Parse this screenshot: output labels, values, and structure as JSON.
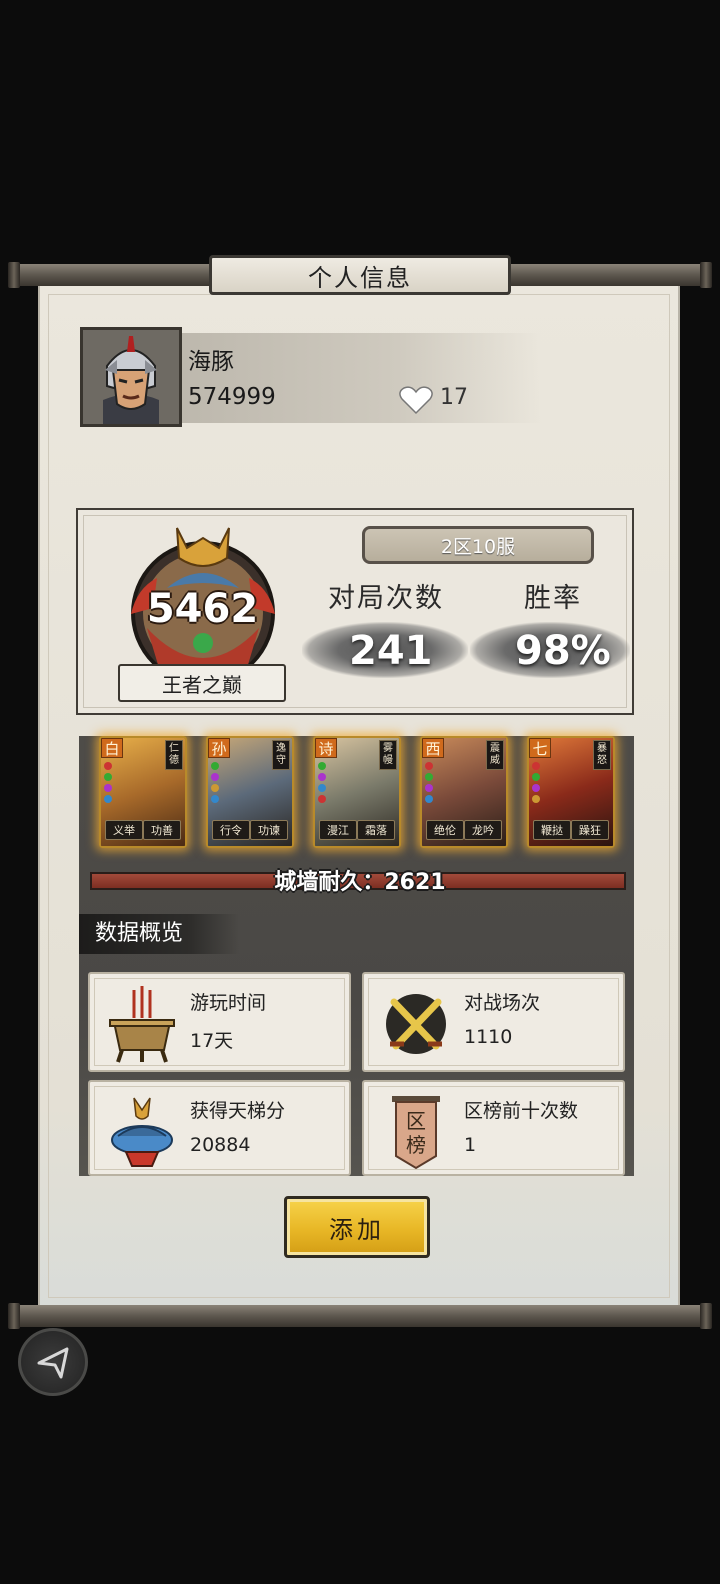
{
  "dialog": {
    "title": "个人信息"
  },
  "profile": {
    "name": "海豚",
    "id": "574999",
    "likes": "17"
  },
  "rank": {
    "score": "5462",
    "tier": "王者之巅",
    "server": "2区10服",
    "games_label": "对局次数",
    "games_value": "241",
    "winrate_label": "胜率",
    "winrate_value": "98%"
  },
  "lineup": [
    {
      "tag": "白",
      "epithet": "仁德",
      "skills": [
        "义举",
        "功善"
      ],
      "colors": {
        "tag": "#d8781f",
        "art": "#a86a2a"
      }
    },
    {
      "tag": "孙",
      "epithet": "逸守",
      "skills": [
        "行令",
        "功谏"
      ],
      "colors": {
        "tag": "#d8781f",
        "art": "#5c6a7a"
      }
    },
    {
      "tag": "诗",
      "epithet": "雾幔",
      "skills": [
        "漫江",
        "霜落"
      ],
      "colors": {
        "tag": "#d8781f",
        "art": "#7a7a6a"
      }
    },
    {
      "tag": "西",
      "epithet": "震威",
      "skills": [
        "绝伦",
        "龙吟"
      ],
      "colors": {
        "tag": "#d8781f",
        "art": "#7a4a3a"
      }
    },
    {
      "tag": "七",
      "epithet": "暴怒",
      "skills": [
        "鞭挞",
        "躁狂"
      ],
      "colors": {
        "tag": "#d8781f",
        "art": "#8a2a1a"
      }
    }
  ],
  "wall": {
    "text": "城墙耐久：2621",
    "durability": 2621
  },
  "overview": {
    "header": "数据概览",
    "cards": [
      {
        "label": "游玩时间",
        "value": "17天",
        "icon": "incense-burner-icon"
      },
      {
        "label": "对战场次",
        "value": "1110",
        "icon": "crossed-swords-icon"
      },
      {
        "label": "获得天梯分",
        "value": "20884",
        "icon": "dragon-trophy-icon"
      },
      {
        "label": "区榜前十次数",
        "value": "1",
        "icon": "ranking-banner-icon",
        "badge": "区\n榜"
      }
    ]
  },
  "actions": {
    "add_label": "添加"
  },
  "theme": {
    "accent": "#e8b726",
    "paper": "#e9e5db",
    "ink": "#222222"
  }
}
